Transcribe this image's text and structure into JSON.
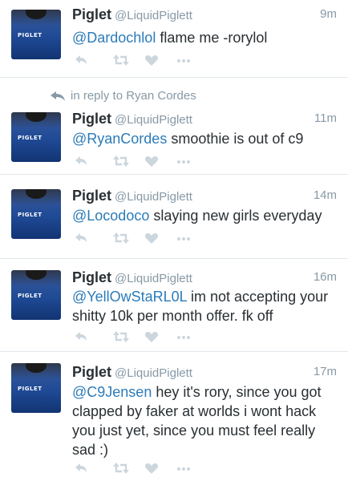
{
  "tweets": [
    {
      "name": "Piglet",
      "handle": "@LiquidPiglett",
      "time": "9m",
      "mention": "@Dardochlol",
      "body": " flame me -rorylol"
    },
    {
      "in_reply_to": "in reply to Ryan Cordes",
      "name": "Piglet",
      "handle": "@LiquidPiglett",
      "time": "11m",
      "mention": "@RyanCordes",
      "body": " smoothie is out of c9"
    },
    {
      "name": "Piglet",
      "handle": "@LiquidPiglett",
      "time": "14m",
      "mention": "@Locodoco",
      "body": " slaying new girls everyday"
    },
    {
      "name": "Piglet",
      "handle": "@LiquidPiglett",
      "time": "16m",
      "mention": "@YellOwStaRL0L",
      "body": " im not accepting your shitty 10k per month offer. fk off"
    },
    {
      "name": "Piglet",
      "handle": "@LiquidPiglett",
      "time": "17m",
      "mention": "@C9Jensen",
      "body": " hey it's rory, since you got clapped by faker at worlds i wont hack you just yet, since you must feel really sad :)"
    }
  ],
  "avatar_logo_text": "PIGLET",
  "icons": [
    "reply-icon",
    "retweet-icon",
    "like-icon",
    "more-icon"
  ],
  "colors": {
    "link": "#2b7bb9",
    "muted": "#8899a6",
    "text": "#292f33",
    "action_icons": "#ccd6dd"
  }
}
